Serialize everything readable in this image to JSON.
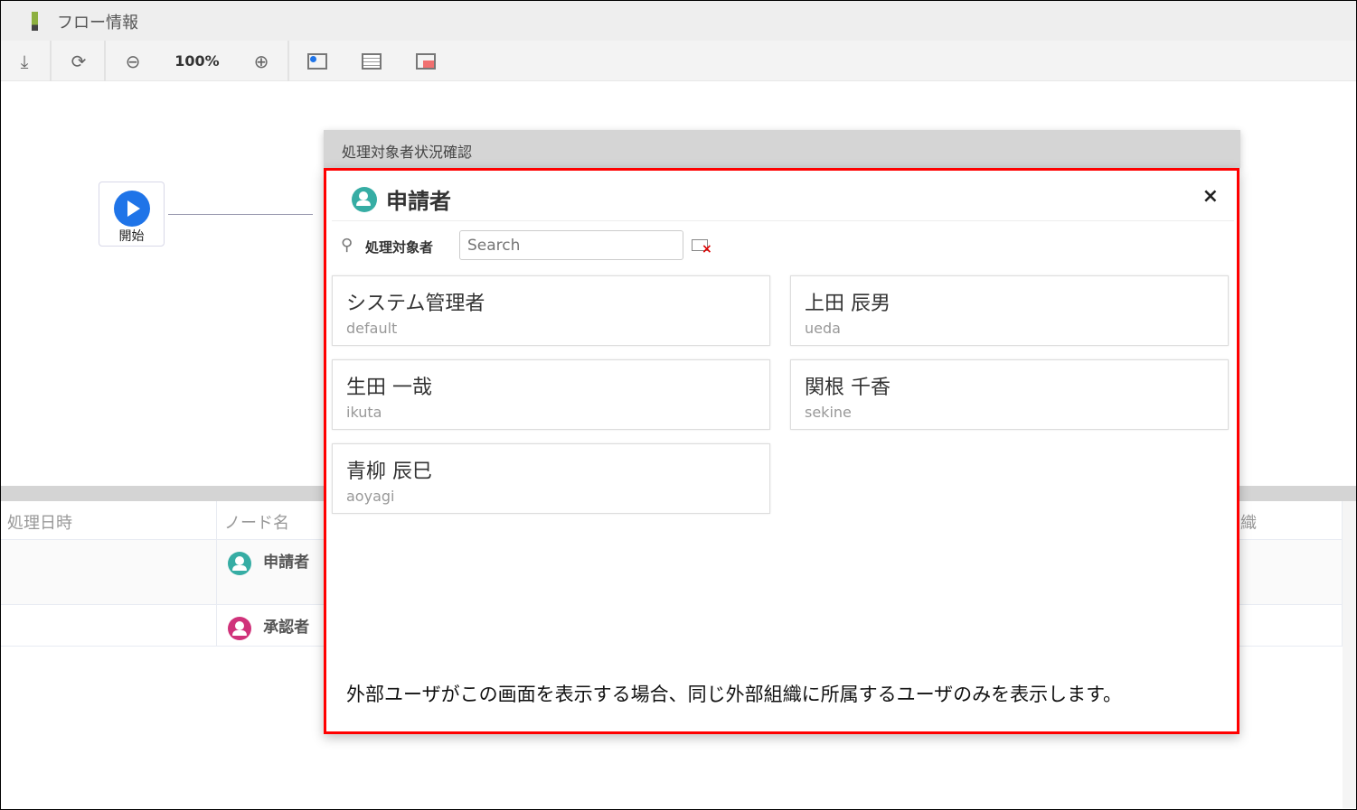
{
  "window": {
    "title": "フロー情報",
    "accent": "#8db040"
  },
  "toolbar": {
    "download": "download-icon",
    "fit": "zoom-fit-icon",
    "zoom_out": "zoom-out-icon",
    "zoom_level": "100%",
    "zoom_in": "zoom-in-icon"
  },
  "flow": {
    "start_label": "開始",
    "start_color": "#1f74e8"
  },
  "history": {
    "columns": [
      "処理日時",
      "ノード名",
      "織"
    ],
    "rows": [
      {
        "date": "",
        "node": "申請者",
        "icon_color": "#36ada4"
      },
      {
        "date": "",
        "node": "承認者",
        "icon_color": "#d0327a"
      }
    ]
  },
  "dialog": {
    "title": "処理対象者状況確認",
    "node_name": "申請者",
    "node_color": "#36ada4",
    "close": "×",
    "search_label": "処理対象者",
    "search_placeholder": "Search",
    "users": [
      {
        "name": "システム管理者",
        "id": "default"
      },
      {
        "name": "上田 辰男",
        "id": "ueda"
      },
      {
        "name": "生田 一哉",
        "id": "ikuta"
      },
      {
        "name": "関根 千香",
        "id": "sekine"
      },
      {
        "name": "青柳 辰巳",
        "id": "aoyagi"
      }
    ],
    "note": "外部ユーザがこの画面を表示する場合、同じ外部組織に所属するユーザのみを表示します。"
  }
}
